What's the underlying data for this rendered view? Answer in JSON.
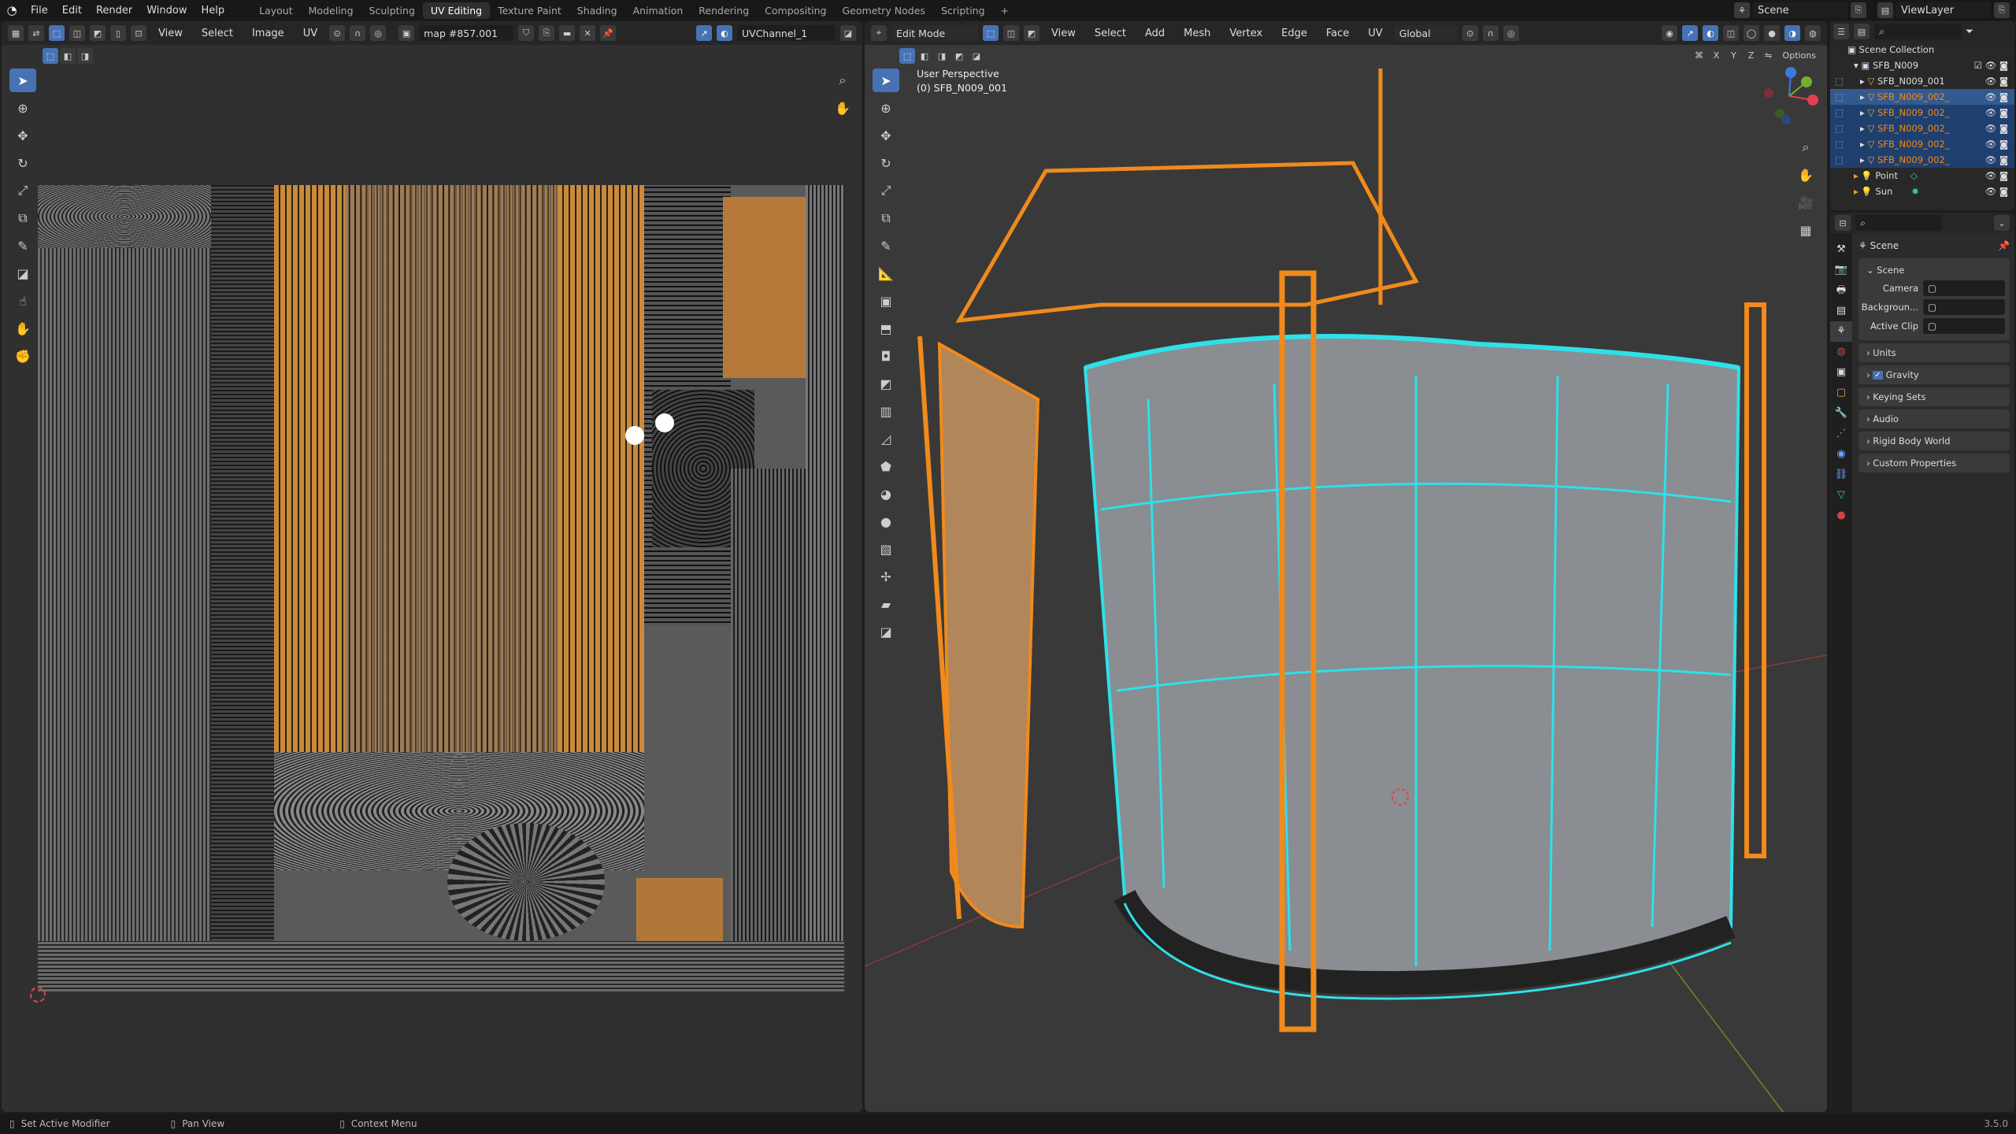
{
  "topbar": {
    "menus": [
      "File",
      "Edit",
      "Render",
      "Window",
      "Help"
    ],
    "workspaces": [
      "Layout",
      "Modeling",
      "Sculpting",
      "UV Editing",
      "Texture Paint",
      "Shading",
      "Animation",
      "Rendering",
      "Compositing",
      "Geometry Nodes",
      "Scripting"
    ],
    "active_workspace": "UV Editing",
    "add_label": "+",
    "scene": "Scene",
    "view_layer": "ViewLayer"
  },
  "uv_editor": {
    "menus": [
      "View",
      "Select",
      "Image",
      "UV"
    ],
    "image_name": "map #857.001",
    "uv_map": "UVChannel_1"
  },
  "viewport": {
    "mode": "Edit Mode",
    "menus": [
      "View",
      "Select",
      "Add",
      "Mesh",
      "Vertex",
      "Edge",
      "Face",
      "UV"
    ],
    "orientation": "Global",
    "axes": [
      "X",
      "Y",
      "Z"
    ],
    "options_label": "Options",
    "overlay_title": "User Perspective",
    "overlay_object": "(0) SFB_N009_001",
    "colors": {
      "wire": "#2fe0e8",
      "selected": "#f08a1c"
    }
  },
  "outliner": {
    "root": "Scene Collection",
    "collection": "SFB_N009",
    "items": [
      {
        "name": "SFB_N009_001",
        "selected": false
      },
      {
        "name": "SFB_N009_002_",
        "selected": true
      },
      {
        "name": "SFB_N009_002_",
        "selected": true
      },
      {
        "name": "SFB_N009_002_",
        "selected": true
      },
      {
        "name": "SFB_N009_002_",
        "selected": true
      },
      {
        "name": "SFB_N009_002_",
        "selected": true
      }
    ],
    "lights": [
      "Point",
      "Sun"
    ]
  },
  "properties": {
    "context": "Scene",
    "panel": "Scene",
    "fields": [
      {
        "label": "Camera"
      },
      {
        "label": "Backgroun..."
      },
      {
        "label": "Active Clip"
      }
    ],
    "sections": [
      "Units",
      "Gravity",
      "Keying Sets",
      "Audio",
      "Rigid Body World",
      "Custom Properties"
    ],
    "gravity_checked": true
  },
  "status": {
    "hints": [
      "Set Active Modifier",
      "Pan View",
      "Context Menu"
    ],
    "version": "3.5.0"
  }
}
